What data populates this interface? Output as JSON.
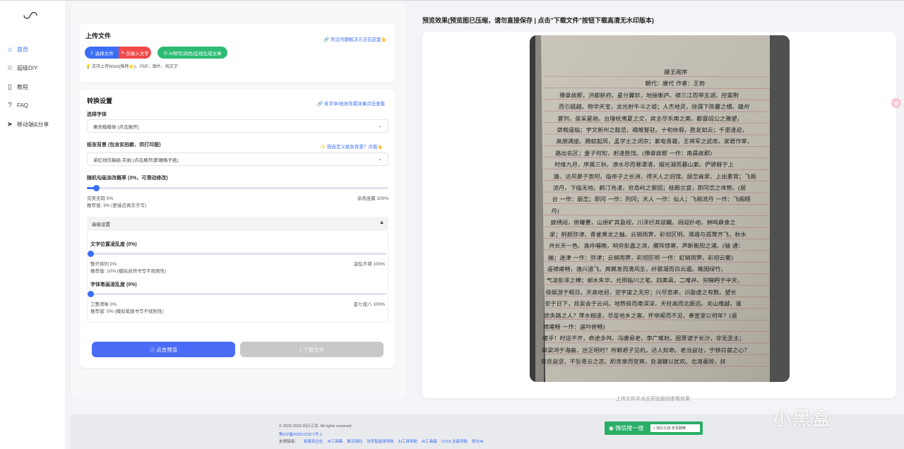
{
  "app": {
    "logo": "◡◠"
  },
  "sidebar": {
    "items": [
      {
        "label": "首页",
        "icon": "home-icon",
        "active": true
      },
      {
        "label": "超级DIY",
        "icon": "star-icon"
      },
      {
        "label": "教程",
        "icon": "book-icon"
      },
      {
        "label": "FAQ",
        "icon": "help-icon"
      },
      {
        "label": "移动端&分享",
        "icon": "send-icon"
      }
    ]
  },
  "upload": {
    "title": "上传文件",
    "faq_link": "常见问题解决方法在这里👆",
    "select_file_btn": "选择文件",
    "text_input_btn": "仅输入文字",
    "ai_btn": "AI帮写|润色|在线生成文章",
    "support_hint": "支持上传Word(推荐🌟)、PDF、图片、纯文字"
  },
  "convert": {
    "title": "转换设置",
    "font_link": "各字体/纸张背景效果点击查看",
    "font_label": "选择字体",
    "font_value": "栗壳楷楷体 (点击展开)",
    "paper_label": "纸张背景 (包含实拍款、供打印版)",
    "paper_link": "想自定义纸张背景？点我👆",
    "paper_value": "单红线信稿纸-实拍 (点击展开|斯珊格子纸)",
    "scribble_label": "随机勾画涂改概率 (3%，可滑动修改)",
    "scribble_min": "完美无瑕 0%",
    "scribble_max": "涂改连篇 100%",
    "scribble_recommend": "推荐值: 3% (更接近真实手写)",
    "scribble_value": 0.03,
    "advanced_label": "高级设置",
    "pos_label": "文字位置凌乱度 (0%)",
    "pos_min": "整齐排列 0%",
    "pos_max": "凌乱不堪 100%",
    "pos_recommend": "推荐值: 10% (模拟自然书写不规则性)",
    "pos_value": 0,
    "stroke_label": "字体笔画凌乱度 (0%)",
    "stroke_min": "工整清晰 0%",
    "stroke_max": "歪七扭八 100%",
    "stroke_recommend": "推荐值: 5% (模拟笔画书写不规则性)",
    "stroke_value": 0,
    "preview_btn": "点击预览",
    "download_btn": "下载文件"
  },
  "preview": {
    "title": "预览效果(预览图已压缩，请勿直接保存 | 点击\"下载文件\"按钮下载高清无水印版本)",
    "below_text": "上传文件并点击预览按钮查看效果",
    "doc_title": "滕王阁序",
    "doc_author": "朝代：唐代  作者：王勃",
    "doc_lines": [
      "豫章故郡，洪都新府。星分翼轸，地接衡庐。襟三江而带五湖，控蛮荆",
      "而引瓯越。物华天宝，龙光射牛斗之墟；人杰地灵，徐孺下陈蕃之榻。雄州",
      "雾列，俊采星驰。台隍枕夷夏之交，宾主尽东南之美。都督阎公之雅望，",
      "棨戟遥临；宇文新州之懿范，襜帷暂驻。十旬休假，胜友如云；千里逢迎，",
      "高朋满座。腾蛟起凤，孟学士之词宗；紫电青霜，王将军之武库。家君作宰，",
      "路出名区；童子何知，躬逢胜饯。(豫章故郡 一作：南昌故郡)",
      "时维九月，序属三秋。潦水尽而寒潭清，烟光凝而暮山紫。俨骖騑于上",
      "路，访风景于崇阿。临帝子之长洲，得天人之旧馆。层峦耸翠，上出重霄；飞阁",
      "流丹，下临无地。鹤汀凫渚，穷岛屿之萦回；桂殿兰宫，即冈峦之体势。(层",
      "台 一作：层峦；即冈 一作：列冈；天人 一作：仙人；飞阁流丹 一作：飞阁翔",
      "丹)",
      "披绣闼，俯雕甍，山原旷其盈视，川泽纡其骇瞩。闾阎扑地，钟鸣鼎食之",
      "家；舸舰弥津，青雀黄龙之舳。云销雨霁，彩彻区明。落霞与孤鹜齐飞，秋水",
      "共长天一色。渔舟唱晚，响穷彭蠡之滨，雁阵惊寒，声断衡阳之浦。(轴 通：",
      "舳；迷津 一作：弥津；云销雨霁，彩彻区明 一作：虹销雨霁，彩彻云衢)",
      "遥襟甫畅，逸兴遄飞。爽籁发而清风生，纤歌凝而白云遏。睢园绿竹，",
      "气凌彭泽之樽；邺水朱华，光照临川之笔。四美具，二难并。穷睇眄于中天，",
      "极娱游于暇日。天高地迥，觉宇宙之无穷；兴尽悲来，识盈虚之有数。望长",
      "安于日下，目吴会于云间。地势极而南溟深，天柱高而北辰远。关山难越，谁",
      "悲失路之人？萍水相逢，尽是他乡之客。怀帝阍而不见，奉宣室以何年？(遥",
      "襟甫畅 一作：遥吟俯畅)",
      "嗟乎！时运不齐，命途多舛。冯唐易老，李广难封。屈贾谊于长沙，非无圣主；",
      "窜梁鸿于海曲，岂乏明时？所赖君子见机，达人知命。老当益壮，宁移白首之心？",
      "穷且益坚，不坠青云之志。酌贪泉而觉爽，处涸辙以犹欢。北海虽赊，扶"
    ]
  },
  "footer": {
    "copyright": "© 2025-2026 凹凸工坊. All rights reserved.",
    "icp": "豫ICP备2025122871号-1",
    "links_label": "友情链接：",
    "links": [
      "极客到边社",
      "AI工具集",
      "聚羽源码",
      "攻壳智能体导航",
      "AI工具导航",
      "AI工具箱",
      "COOL全能导航",
      "即方AI"
    ],
    "wechat_label": "微信搜一搜",
    "wechat_query": "凹凸工坊·手写转换"
  },
  "watermark": "小黑盒",
  "colors": {
    "accent": "#3b6ef5",
    "danger": "#f04a4a",
    "success": "#2dbb74",
    "wechat": "#2aae67"
  }
}
